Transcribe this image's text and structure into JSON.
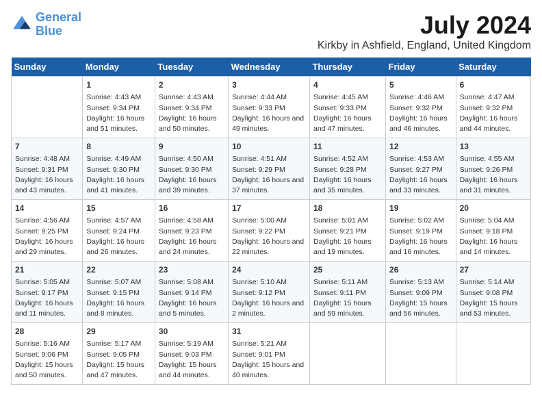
{
  "logo": {
    "line1": "General",
    "line2": "Blue"
  },
  "title": "July 2024",
  "location": "Kirkby in Ashfield, England, United Kingdom",
  "days_of_week": [
    "Sunday",
    "Monday",
    "Tuesday",
    "Wednesday",
    "Thursday",
    "Friday",
    "Saturday"
  ],
  "weeks": [
    [
      {
        "day": "",
        "sunrise": "",
        "sunset": "",
        "daylight": ""
      },
      {
        "day": "1",
        "sunrise": "Sunrise: 4:43 AM",
        "sunset": "Sunset: 9:34 PM",
        "daylight": "Daylight: 16 hours and 51 minutes."
      },
      {
        "day": "2",
        "sunrise": "Sunrise: 4:43 AM",
        "sunset": "Sunset: 9:34 PM",
        "daylight": "Daylight: 16 hours and 50 minutes."
      },
      {
        "day": "3",
        "sunrise": "Sunrise: 4:44 AM",
        "sunset": "Sunset: 9:33 PM",
        "daylight": "Daylight: 16 hours and 49 minutes."
      },
      {
        "day": "4",
        "sunrise": "Sunrise: 4:45 AM",
        "sunset": "Sunset: 9:33 PM",
        "daylight": "Daylight: 16 hours and 47 minutes."
      },
      {
        "day": "5",
        "sunrise": "Sunrise: 4:46 AM",
        "sunset": "Sunset: 9:32 PM",
        "daylight": "Daylight: 16 hours and 46 minutes."
      },
      {
        "day": "6",
        "sunrise": "Sunrise: 4:47 AM",
        "sunset": "Sunset: 9:32 PM",
        "daylight": "Daylight: 16 hours and 44 minutes."
      }
    ],
    [
      {
        "day": "7",
        "sunrise": "Sunrise: 4:48 AM",
        "sunset": "Sunset: 9:31 PM",
        "daylight": "Daylight: 16 hours and 43 minutes."
      },
      {
        "day": "8",
        "sunrise": "Sunrise: 4:49 AM",
        "sunset": "Sunset: 9:30 PM",
        "daylight": "Daylight: 16 hours and 41 minutes."
      },
      {
        "day": "9",
        "sunrise": "Sunrise: 4:50 AM",
        "sunset": "Sunset: 9:30 PM",
        "daylight": "Daylight: 16 hours and 39 minutes."
      },
      {
        "day": "10",
        "sunrise": "Sunrise: 4:51 AM",
        "sunset": "Sunset: 9:29 PM",
        "daylight": "Daylight: 16 hours and 37 minutes."
      },
      {
        "day": "11",
        "sunrise": "Sunrise: 4:52 AM",
        "sunset": "Sunset: 9:28 PM",
        "daylight": "Daylight: 16 hours and 35 minutes."
      },
      {
        "day": "12",
        "sunrise": "Sunrise: 4:53 AM",
        "sunset": "Sunset: 9:27 PM",
        "daylight": "Daylight: 16 hours and 33 minutes."
      },
      {
        "day": "13",
        "sunrise": "Sunrise: 4:55 AM",
        "sunset": "Sunset: 9:26 PM",
        "daylight": "Daylight: 16 hours and 31 minutes."
      }
    ],
    [
      {
        "day": "14",
        "sunrise": "Sunrise: 4:56 AM",
        "sunset": "Sunset: 9:25 PM",
        "daylight": "Daylight: 16 hours and 29 minutes."
      },
      {
        "day": "15",
        "sunrise": "Sunrise: 4:57 AM",
        "sunset": "Sunset: 9:24 PM",
        "daylight": "Daylight: 16 hours and 26 minutes."
      },
      {
        "day": "16",
        "sunrise": "Sunrise: 4:58 AM",
        "sunset": "Sunset: 9:23 PM",
        "daylight": "Daylight: 16 hours and 24 minutes."
      },
      {
        "day": "17",
        "sunrise": "Sunrise: 5:00 AM",
        "sunset": "Sunset: 9:22 PM",
        "daylight": "Daylight: 16 hours and 22 minutes."
      },
      {
        "day": "18",
        "sunrise": "Sunrise: 5:01 AM",
        "sunset": "Sunset: 9:21 PM",
        "daylight": "Daylight: 16 hours and 19 minutes."
      },
      {
        "day": "19",
        "sunrise": "Sunrise: 5:02 AM",
        "sunset": "Sunset: 9:19 PM",
        "daylight": "Daylight: 16 hours and 16 minutes."
      },
      {
        "day": "20",
        "sunrise": "Sunrise: 5:04 AM",
        "sunset": "Sunset: 9:18 PM",
        "daylight": "Daylight: 16 hours and 14 minutes."
      }
    ],
    [
      {
        "day": "21",
        "sunrise": "Sunrise: 5:05 AM",
        "sunset": "Sunset: 9:17 PM",
        "daylight": "Daylight: 16 hours and 11 minutes."
      },
      {
        "day": "22",
        "sunrise": "Sunrise: 5:07 AM",
        "sunset": "Sunset: 9:15 PM",
        "daylight": "Daylight: 16 hours and 8 minutes."
      },
      {
        "day": "23",
        "sunrise": "Sunrise: 5:08 AM",
        "sunset": "Sunset: 9:14 PM",
        "daylight": "Daylight: 16 hours and 5 minutes."
      },
      {
        "day": "24",
        "sunrise": "Sunrise: 5:10 AM",
        "sunset": "Sunset: 9:12 PM",
        "daylight": "Daylight: 16 hours and 2 minutes."
      },
      {
        "day": "25",
        "sunrise": "Sunrise: 5:11 AM",
        "sunset": "Sunset: 9:11 PM",
        "daylight": "Daylight: 15 hours and 59 minutes."
      },
      {
        "day": "26",
        "sunrise": "Sunrise: 5:13 AM",
        "sunset": "Sunset: 9:09 PM",
        "daylight": "Daylight: 15 hours and 56 minutes."
      },
      {
        "day": "27",
        "sunrise": "Sunrise: 5:14 AM",
        "sunset": "Sunset: 9:08 PM",
        "daylight": "Daylight: 15 hours and 53 minutes."
      }
    ],
    [
      {
        "day": "28",
        "sunrise": "Sunrise: 5:16 AM",
        "sunset": "Sunset: 9:06 PM",
        "daylight": "Daylight: 15 hours and 50 minutes."
      },
      {
        "day": "29",
        "sunrise": "Sunrise: 5:17 AM",
        "sunset": "Sunset: 9:05 PM",
        "daylight": "Daylight: 15 hours and 47 minutes."
      },
      {
        "day": "30",
        "sunrise": "Sunrise: 5:19 AM",
        "sunset": "Sunset: 9:03 PM",
        "daylight": "Daylight: 15 hours and 44 minutes."
      },
      {
        "day": "31",
        "sunrise": "Sunrise: 5:21 AM",
        "sunset": "Sunset: 9:01 PM",
        "daylight": "Daylight: 15 hours and 40 minutes."
      },
      {
        "day": "",
        "sunrise": "",
        "sunset": "",
        "daylight": ""
      },
      {
        "day": "",
        "sunrise": "",
        "sunset": "",
        "daylight": ""
      },
      {
        "day": "",
        "sunrise": "",
        "sunset": "",
        "daylight": ""
      }
    ]
  ]
}
